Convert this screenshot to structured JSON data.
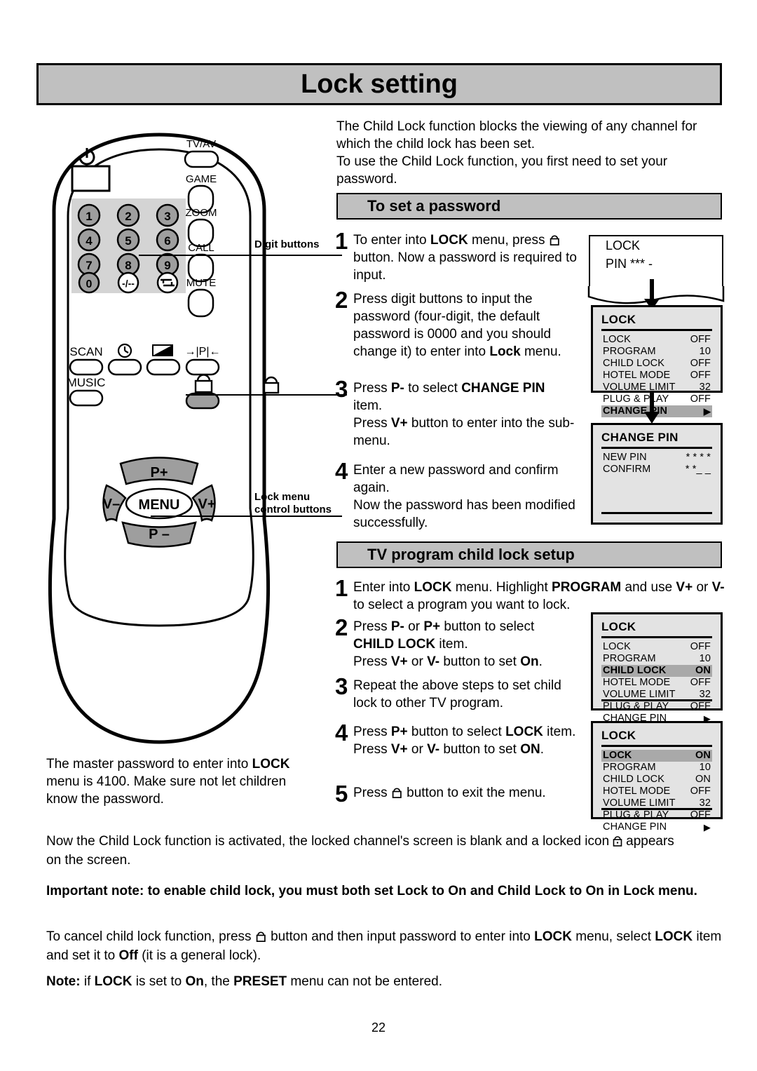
{
  "page": {
    "title": "Lock setting",
    "number": "22"
  },
  "intro": {
    "line1": "The Child Lock function blocks the viewing of any channel for",
    "line2": "which the child lock has been set.",
    "line3": "To use the Child Lock function, you first need to set your",
    "line4": "password."
  },
  "sections": {
    "password": "To set a password",
    "childlock": "TV program child lock setup"
  },
  "password_steps": [
    {
      "num": "1",
      "html": "To enter into <b>LOCK</b> menu, press <span class=\"lockglyph-slot\"></span> button. Now a password is required to input."
    },
    {
      "num": "2",
      "html": "Press digit buttons to input the password (four-digit, the default password is 0000 and you should change it) to enter into <b>Lock</b> menu."
    },
    {
      "num": "3",
      "html": "Press <b>P-</b> to select <b>CHANGE PIN</b> item.<br>Press <b>V+</b> button to enter into the sub-menu."
    },
    {
      "num": "4",
      "html": "Enter a new password and confirm again.<br>Now the password has been modified successfully."
    }
  ],
  "childlock_steps": [
    {
      "num": "1",
      "html": "Enter into <b>LOCK</b> menu. Highlight <b>PROGRAM</b> and use <b>V+</b> or <b>V-</b> to select a program you want to lock."
    },
    {
      "num": "2",
      "html": "Press <b>P-</b> or <b>P+</b> button to select <b>CHILD LOCK</b> item.<br>Press <b>V+</b> or <b>V-</b> button to set <b>On</b>."
    },
    {
      "num": "3",
      "html": "Repeat the above steps to set child lock to other TV program."
    },
    {
      "num": "4",
      "html": "Press <b>P+</b> button to select <b>LOCK</b> item.<br>Press <b>V+</b> or <b>V-</b> button to set <b>ON</b>."
    },
    {
      "num": "5",
      "html": "Press <span class=\"lockglyph-slot\"></span> button to exit the menu."
    }
  ],
  "pin_screen": {
    "line1": "LOCK",
    "line2": "PIN *** -"
  },
  "osd_lock_1": {
    "title": "LOCK",
    "rows": [
      {
        "label": "LOCK",
        "value": "OFF",
        "highlight": false
      },
      {
        "label": "PROGRAM",
        "value": "10",
        "highlight": false
      },
      {
        "label": "CHILD LOCK",
        "value": "OFF",
        "highlight": false
      },
      {
        "label": "HOTEL MODE",
        "value": "OFF",
        "highlight": false
      },
      {
        "label": "VOLUME LIMIT",
        "value": "32",
        "highlight": false
      },
      {
        "label": "PLUG & PLAY",
        "value": "OFF",
        "highlight": false
      },
      {
        "label": "CHANGE PIN",
        "value": "▶",
        "highlight": true
      }
    ]
  },
  "osd_change_pin": {
    "title": "CHANGE PIN",
    "rows": [
      {
        "label": "NEW PIN",
        "value": "* * * *",
        "highlight": false
      },
      {
        "label": "CONFIRM",
        "value": "* *_ _",
        "highlight": false
      }
    ]
  },
  "osd_lock_2": {
    "title": "LOCK",
    "rows": [
      {
        "label": "LOCK",
        "value": "OFF",
        "highlight": false
      },
      {
        "label": "PROGRAM",
        "value": "10",
        "highlight": false
      },
      {
        "label": "CHILD LOCK",
        "value": "ON",
        "highlight": true
      },
      {
        "label": "HOTEL MODE",
        "value": "OFF",
        "highlight": false
      },
      {
        "label": "VOLUME LIMIT",
        "value": "32",
        "highlight": false
      },
      {
        "label": "PLUG & PLAY",
        "value": "OFF",
        "highlight": false
      },
      {
        "label": "CHANGE PIN",
        "value": "▶",
        "highlight": false
      }
    ]
  },
  "osd_lock_3": {
    "title": "LOCK",
    "rows": [
      {
        "label": "LOCK",
        "value": "ON",
        "highlight": true
      },
      {
        "label": "PROGRAM",
        "value": "10",
        "highlight": false
      },
      {
        "label": "CHILD LOCK",
        "value": "ON",
        "highlight": false
      },
      {
        "label": "HOTEL MODE",
        "value": "OFF",
        "highlight": false
      },
      {
        "label": "VOLUME LIMIT",
        "value": "32",
        "highlight": false
      },
      {
        "label": "PLUG & PLAY",
        "value": "OFF",
        "highlight": false
      },
      {
        "label": "CHANGE PIN",
        "value": "▶",
        "highlight": false
      }
    ]
  },
  "remote": {
    "power_icon": "power-icon",
    "keypad": [
      "1",
      "2",
      "3",
      "4",
      "5",
      "6",
      "7",
      "8",
      "9",
      "0",
      "-/--",
      "icon-dashdash"
    ],
    "right_buttons": [
      "TV/AV",
      "GAME",
      "ZOOM",
      "CALL",
      "MUTE"
    ],
    "function_row": [
      "SCAN",
      "clock-icon",
      "contrast-icon",
      "pip-icon"
    ],
    "music_label": "MUSIC",
    "lock_button_icon": "padlock-icon",
    "nav": {
      "up": "P+",
      "down": "P –",
      "left": "V–",
      "right": "V+",
      "center": "MENU"
    }
  },
  "callouts": {
    "digit_buttons": "Digit buttons",
    "lock_menu_line1": "Lock menu",
    "lock_menu_line2": "control buttons"
  },
  "master_note": {
    "line1": "The master password to enter into <b>LOCK</b>",
    "line2": "menu is 4100. Make sure not let children",
    "line3": "know the password."
  },
  "bottom_notes": {
    "activated_pre": "Now the Child Lock function is activated, the locked channel's screen is blank and a locked icon",
    "activated_post": "appears",
    "activated_line2": "on the screen.",
    "important": "Important note: to enable child lock, you must both set Lock to On and Child Lock to On in Lock menu.",
    "cancel_html": "To cancel child lock function, press <span class=\"lockglyph-slot\"></span> button and then input password to enter into <b>LOCK</b> menu, select <b>LOCK</b> item and set it to <b>Off</b> (it is a general lock).",
    "note_html": "<b>Note:</b> if <b>LOCK</b> is set to <b>On</b>, the <b>PRESET</b> menu can not be entered."
  },
  "colors": {
    "header_gray": "#c0c0c0",
    "osd_bg": "#e3e3e3",
    "highlight_gray": "#a9a9a9",
    "button_gray": "#9e9e9e",
    "keypad_bg": "#d4d4d4"
  }
}
